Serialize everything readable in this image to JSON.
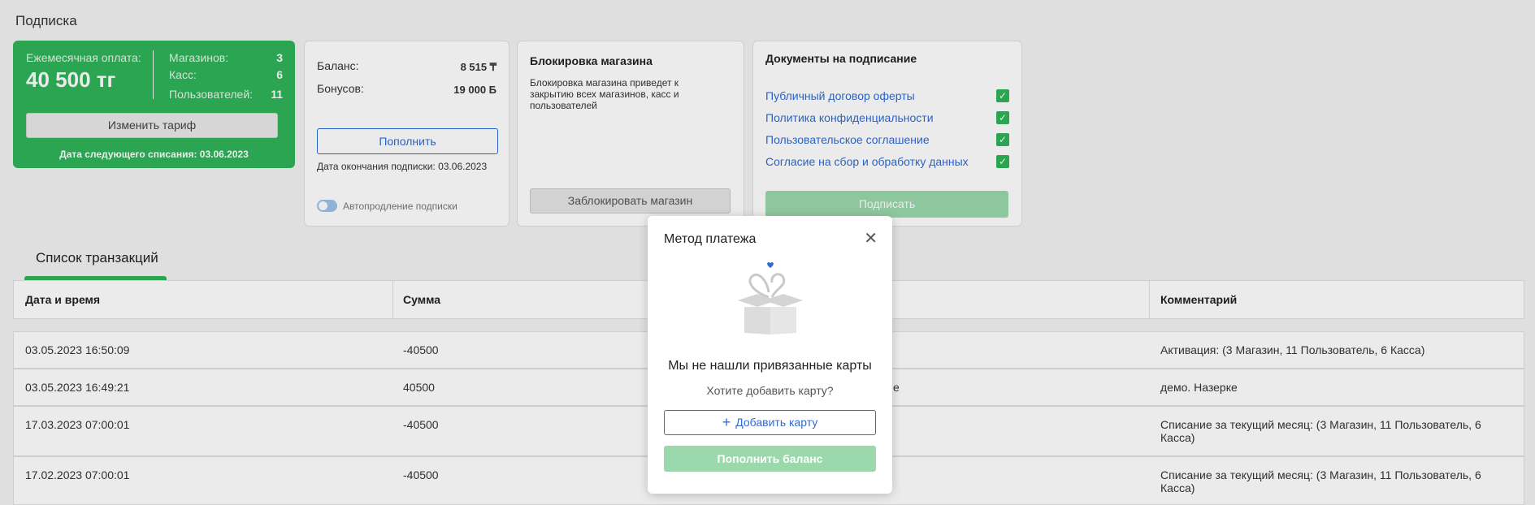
{
  "page": {
    "title": "Подписка"
  },
  "subscription": {
    "monthly_label": "Ежемесячная оплата:",
    "monthly_amount": "40 500 тг",
    "stores_label": "Магазинов:",
    "stores_value": "3",
    "cash_label": "Касс:",
    "cash_value": "6",
    "users_label": "Пользователей:",
    "users_value": "11",
    "change_tariff_label": "Изменить тариф",
    "next_charge": "Дата следующего списания: 03.06.2023",
    "accent_color": "#2fb35a"
  },
  "balance": {
    "balance_label": "Баланс:",
    "balance_value": "8 515 ₸",
    "bonus_label": "Бонусов:",
    "bonus_value": "19 000 Б",
    "topup_label": "Пополнить",
    "end_date": "Дата окончания подписки: 03.06.2023",
    "auto_renew_label": "Автопродление подписки"
  },
  "block": {
    "title": "Блокировка магазина",
    "description": "Блокировка магазина приведет к закрытию всех магазинов, касс и пользователей",
    "button_label": "Заблокировать магазин"
  },
  "documents": {
    "title": "Документы на подписание",
    "items": [
      {
        "label": "Публичный договор оферты"
      },
      {
        "label": "Политика конфиденциальности"
      },
      {
        "label": "Пользовательское соглашение"
      },
      {
        "label": "Согласие на сбор и обработку данных"
      }
    ],
    "sign_label": "Подписать"
  },
  "transactions": {
    "tab_label": "Список транзакций",
    "columns": [
      "Дата и время",
      "Сумма",
      "Комментарий"
    ],
    "rows": [
      {
        "date": "03.05.2023 16:50:09",
        "amount": "-40500",
        "middle": "",
        "comment": "Активация: (3 Магазин, 11 Пользователь, 6 Касса)"
      },
      {
        "date": "03.05.2023 16:49:21",
        "amount": "40500",
        "middle": "е",
        "comment": "демо. Назерке"
      },
      {
        "date": "17.03.2023 07:00:01",
        "amount": "-40500",
        "middle": "",
        "comment": "Списание за текущий месяц: (3 Магазин, 11 Пользователь, 6 Касса)"
      },
      {
        "date": "17.02.2023 07:00:01",
        "amount": "-40500",
        "middle": "",
        "comment": "Списание за текущий месяц: (3 Магазин, 11 Пользователь, 6 Касса)"
      }
    ]
  },
  "modal": {
    "title": "Метод платежа",
    "close_icon": "close-icon",
    "illustration_icon": "gift-box-icon",
    "message": "Мы не нашли привязанные карты",
    "question": "Хотите добавить карту?",
    "add_card_label": "Добавить карту",
    "topup_balance_label": "Пополнить баланс"
  }
}
